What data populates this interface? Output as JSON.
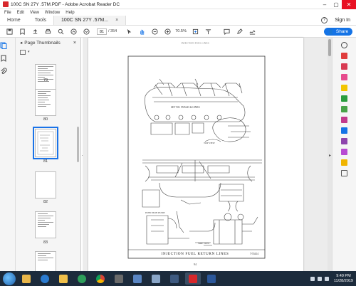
{
  "window": {
    "title": "100C SN 27Y .57M.PDF - Adobe Acrobat Reader DC",
    "controls": [
      "–",
      "▢",
      "✕"
    ]
  },
  "menu": [
    "File",
    "Edit",
    "View",
    "Window",
    "Help"
  ],
  "tabs": {
    "home": "Home",
    "tools": "Tools",
    "document": "100C SN 27Y .57M...",
    "close": "×",
    "help": "?",
    "signin": "Sign In"
  },
  "toolbar": {
    "page_current": "81",
    "page_total": "/ 354",
    "zoom": "70.5%",
    "share": "Share"
  },
  "thumbnails": {
    "header": "Page Thumbnails",
    "close": "×",
    "pages": [
      {
        "label": "79",
        "selected": false
      },
      {
        "label": "80",
        "selected": false
      },
      {
        "label": "81",
        "selected": true
      },
      {
        "label": "82",
        "selected": false
      },
      {
        "label": "83",
        "selected": false
      }
    ]
  },
  "document": {
    "header_text": "INJECTION FUEL LINES",
    "callout_1": "SET NO. 9N5243 & LINES",
    "callout_2": "TOP VIEW",
    "callout_3": "INJECTION PUMP",
    "callout_4": "SIDE VIEW",
    "caption": "INJECTION FUEL RETURN LINES",
    "figure_number": "T-55414",
    "page_number": "94"
  },
  "taskbar": {
    "time": "9:49 PM",
    "date": "11/28/2019"
  },
  "colors": {
    "accent": "#1473e6",
    "close_red": "#e81123",
    "taskbar": "#1c2b3c"
  }
}
